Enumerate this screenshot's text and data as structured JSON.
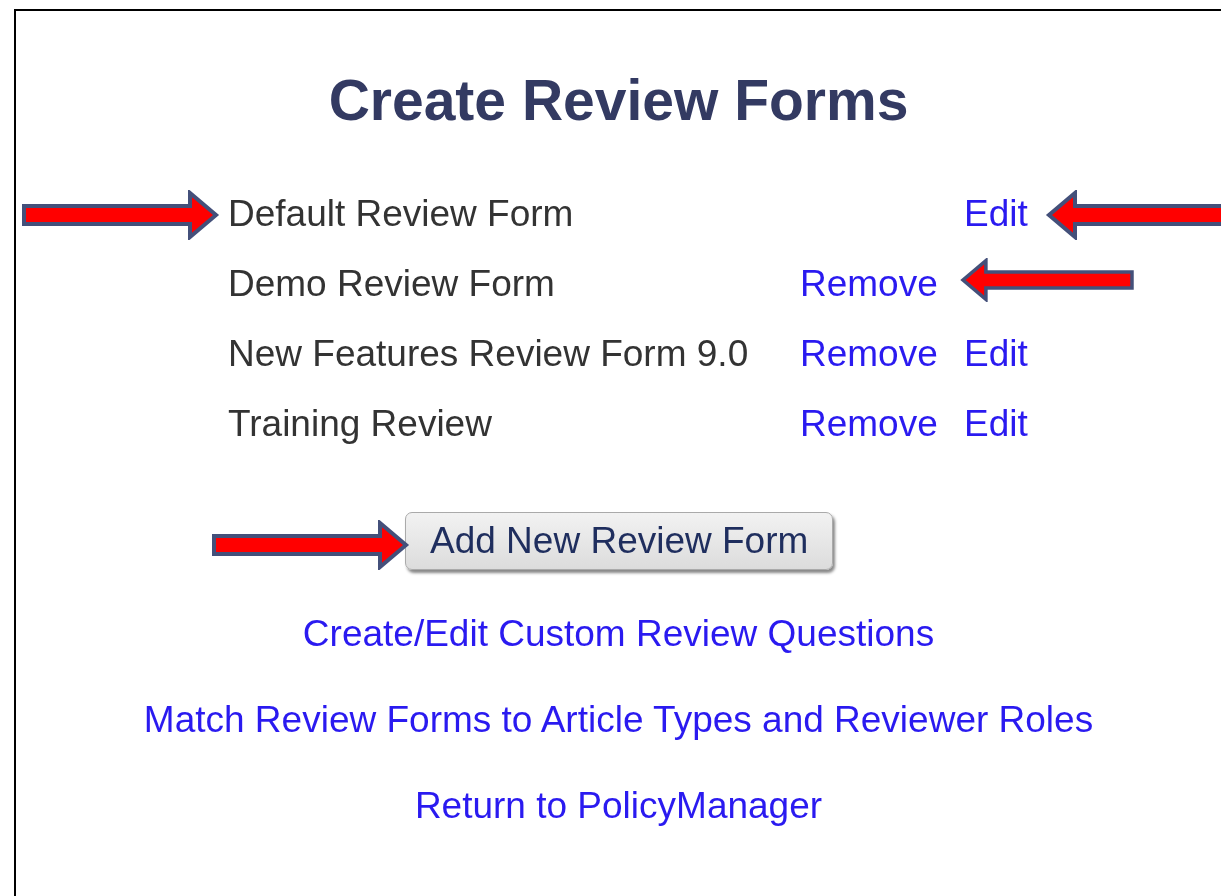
{
  "title": "Create Review Forms",
  "forms": [
    {
      "name": "Default Review Form",
      "edit": "Edit"
    },
    {
      "name": "Demo Review Form",
      "remove": "Remove"
    },
    {
      "name": "New Features Review Form 9.0",
      "remove": "Remove",
      "edit": "Edit"
    },
    {
      "name": "Training Review",
      "remove": "Remove",
      "edit": "Edit"
    }
  ],
  "add_button": "Add New Review Form",
  "links": [
    "Create/Edit Custom Review Questions",
    "Match Review Forms to Article Types and Reviewer Roles",
    "Return to PolicyManager"
  ]
}
